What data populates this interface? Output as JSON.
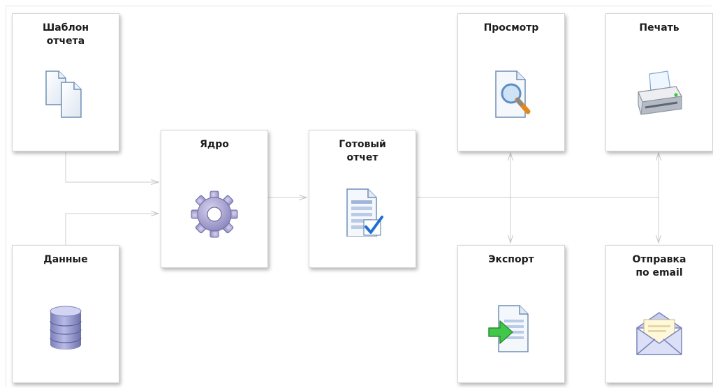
{
  "nodes": {
    "template": {
      "title": "Шаблон\nотчета",
      "icon": "documents-icon"
    },
    "data": {
      "title": "Данные",
      "icon": "database-icon"
    },
    "core": {
      "title": "Ядро",
      "icon": "gear-icon"
    },
    "ready": {
      "title": "Готовый\nотчет",
      "icon": "report-check-icon"
    },
    "preview": {
      "title": "Просмотр",
      "icon": "magnifier-document-icon"
    },
    "print": {
      "title": "Печать",
      "icon": "printer-icon"
    },
    "export": {
      "title": "Экспорт",
      "icon": "export-arrow-icon"
    },
    "email": {
      "title": "Отправка\nпо email",
      "icon": "envelope-icon"
    }
  },
  "edges": [
    {
      "from": "template",
      "to": "core"
    },
    {
      "from": "data",
      "to": "core"
    },
    {
      "from": "core",
      "to": "ready"
    },
    {
      "from": "ready",
      "to": "preview"
    },
    {
      "from": "ready",
      "to": "export"
    },
    {
      "from": "ready",
      "to": "print"
    },
    {
      "from": "ready",
      "to": "email"
    }
  ],
  "colors": {
    "connector": "#cccccc",
    "box_border": "#d4d4d4",
    "title_text": "#1c1c1c"
  }
}
